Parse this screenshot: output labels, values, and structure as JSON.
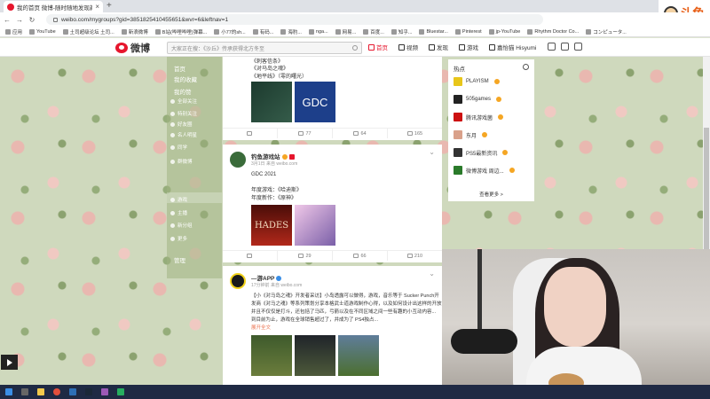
{
  "browser": {
    "tab_title": "我的首页 微博-随时随地发现新鲜事",
    "tab_close": "×",
    "new_tab": "+",
    "url": "weibo.com/mygroups?gid=3851825410455651&wvr=6&leftnav=1",
    "window_controls": [
      "–",
      "□",
      "×"
    ],
    "bookmarks": [
      "应用",
      "YouTube",
      "土司超级论坛 土司...",
      "新浪微博",
      "B站(哔哩哔哩)弹幕...",
      "小77的sh...",
      "有码...",
      "海豹...",
      "nga...",
      "网易...",
      "百度...",
      "知乎...",
      "Bluestar...",
      "Pinterest",
      "jp-YouTube",
      "Rhythm Doctor Co...",
      "コンピュータ..."
    ],
    "logo_text": "斗鱼"
  },
  "weibo_nav": {
    "logo_text": "微博",
    "search_placeholder": "大家正在搜：《沙丘》传承获得北方冬至",
    "menu": [
      {
        "label": "首页",
        "active": true
      },
      {
        "label": "视频",
        "active": false
      },
      {
        "label": "发现",
        "active": false
      },
      {
        "label": "游戏",
        "active": false
      },
      {
        "label": "嘉怡猫 Hisyumi",
        "active": false
      }
    ]
  },
  "left_nav": {
    "items": [
      {
        "label": "首页"
      },
      {
        "label": "我的收藏"
      },
      {
        "label": "我的赞"
      },
      {
        "label": "全部关注"
      },
      {
        "label": "特别关注"
      },
      {
        "label": "好友圈"
      },
      {
        "label": "名人明星"
      },
      {
        "label": "同学"
      },
      {
        "label": "群微博"
      },
      {
        "label": "游戏"
      },
      {
        "label": "主播"
      },
      {
        "label": "新分组"
      },
      {
        "label": "更多"
      },
      {
        "label": "管理"
      }
    ]
  },
  "feed": {
    "post1": {
      "lines": [
        "《刺客信条》",
        "《对马岛之魂》",
        "《地平线》（零的曙光）"
      ],
      "actions": [
        "",
        "77",
        "64",
        "165"
      ]
    },
    "post2": {
      "user": "钓鱼游戏站",
      "meta": "3月1日 来自 weibo.com",
      "lines": [
        "GDC 2021",
        "年度游戏：《哈迪斯》",
        "年度新作：《原神》"
      ],
      "actions": [
        "",
        "29",
        "66",
        "210"
      ],
      "image_labels": [
        "HADES",
        "GDC"
      ]
    },
    "post3": {
      "user": "—游APP",
      "meta": "17分钟前 来自 weibo.com",
      "lines": [
        "【小《对马岛之魂》开发者采访】小岛透露可以做得，游戏，音乐等于 Sucker Punch开",
        "发商《对马之魂》等系列策划分享本格武士道游戏制作心得，以及如何设计出这样的开放世界，",
        "并且不仅仅是打斗，还包括了马匹，弓箭以及在不同区域之间一些有趣的小互动内容...",
        "到目前为止，游戏在全球销售超过了，并成为了 PS4独占..."
      ],
      "expand": "展开全文"
    }
  },
  "right_panel": {
    "title": "热点",
    "items": [
      {
        "name": "PLAYISM",
        "color": "#e8c61a"
      },
      {
        "name": "505games",
        "color": "#222222"
      },
      {
        "name": "腾讯游戏菌",
        "color": "#cc1111"
      },
      {
        "name": "东月",
        "color": "#d9a18a"
      },
      {
        "name": "PS5最新资讯",
        "color": "#333333"
      },
      {
        "name": "微博游戏 周边...",
        "color": "#2a7a2a"
      }
    ],
    "more": "查看更多 >"
  },
  "colors": {
    "accent": "#e6162d",
    "floral_bg": "#cfd9bd",
    "taskbar": "#1f2a44"
  }
}
